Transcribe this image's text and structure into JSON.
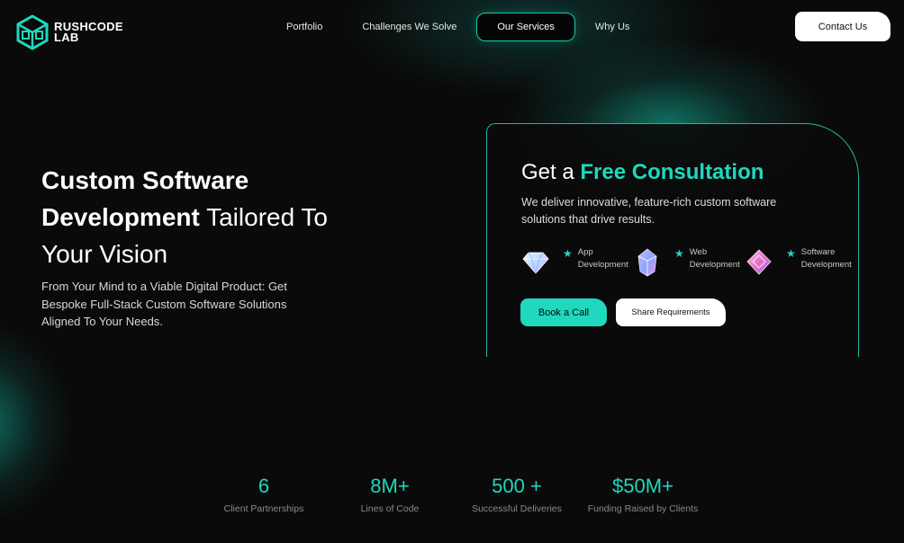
{
  "brand": {
    "name_line1": "RUSHCODE",
    "name_line2": "LAB"
  },
  "nav": {
    "items": [
      {
        "label": "Portfolio"
      },
      {
        "label": "Challenges We Solve"
      },
      {
        "label": "Our Services"
      },
      {
        "label": "Why Us"
      }
    ],
    "active": "Our Services",
    "contact_label": "Contact Us"
  },
  "hero": {
    "title_bold_1": "Custom Software",
    "title_bold_2": "Development",
    "title_rest_1": " Tailored To",
    "title_rest_2": "Your Vision",
    "subtitle": "From Your Mind to a Viable Digital Product: Get Bespoke Full-Stack Custom Software Solutions Aligned To Your Needs."
  },
  "consultation": {
    "title_plain": "Get a ",
    "title_accent": "Free Consultation",
    "description": "We deliver innovative, feature-rich custom software solutions that drive results.",
    "services": [
      {
        "line1": "App",
        "line2": "Development",
        "icon": "diamond-gem-icon"
      },
      {
        "line1": "Web",
        "line2": "Development",
        "icon": "crystal-gem-icon"
      },
      {
        "line1": "Software",
        "line2": "Development",
        "icon": "pink-gem-icon"
      }
    ],
    "book_label": "Book a Call",
    "share_label": "Share Requirements"
  },
  "stats": [
    {
      "value": "6",
      "label": "Client Partnerships"
    },
    {
      "value": "8M+",
      "label": "Lines of Code"
    },
    {
      "value": "500 +",
      "label": "Successful Deliveries"
    },
    {
      "value": "$50M+",
      "label": "Funding Raised by Clients"
    }
  ],
  "colors": {
    "accent": "#1fd8bd",
    "background": "#0a0a0a",
    "text": "#ffffff"
  }
}
